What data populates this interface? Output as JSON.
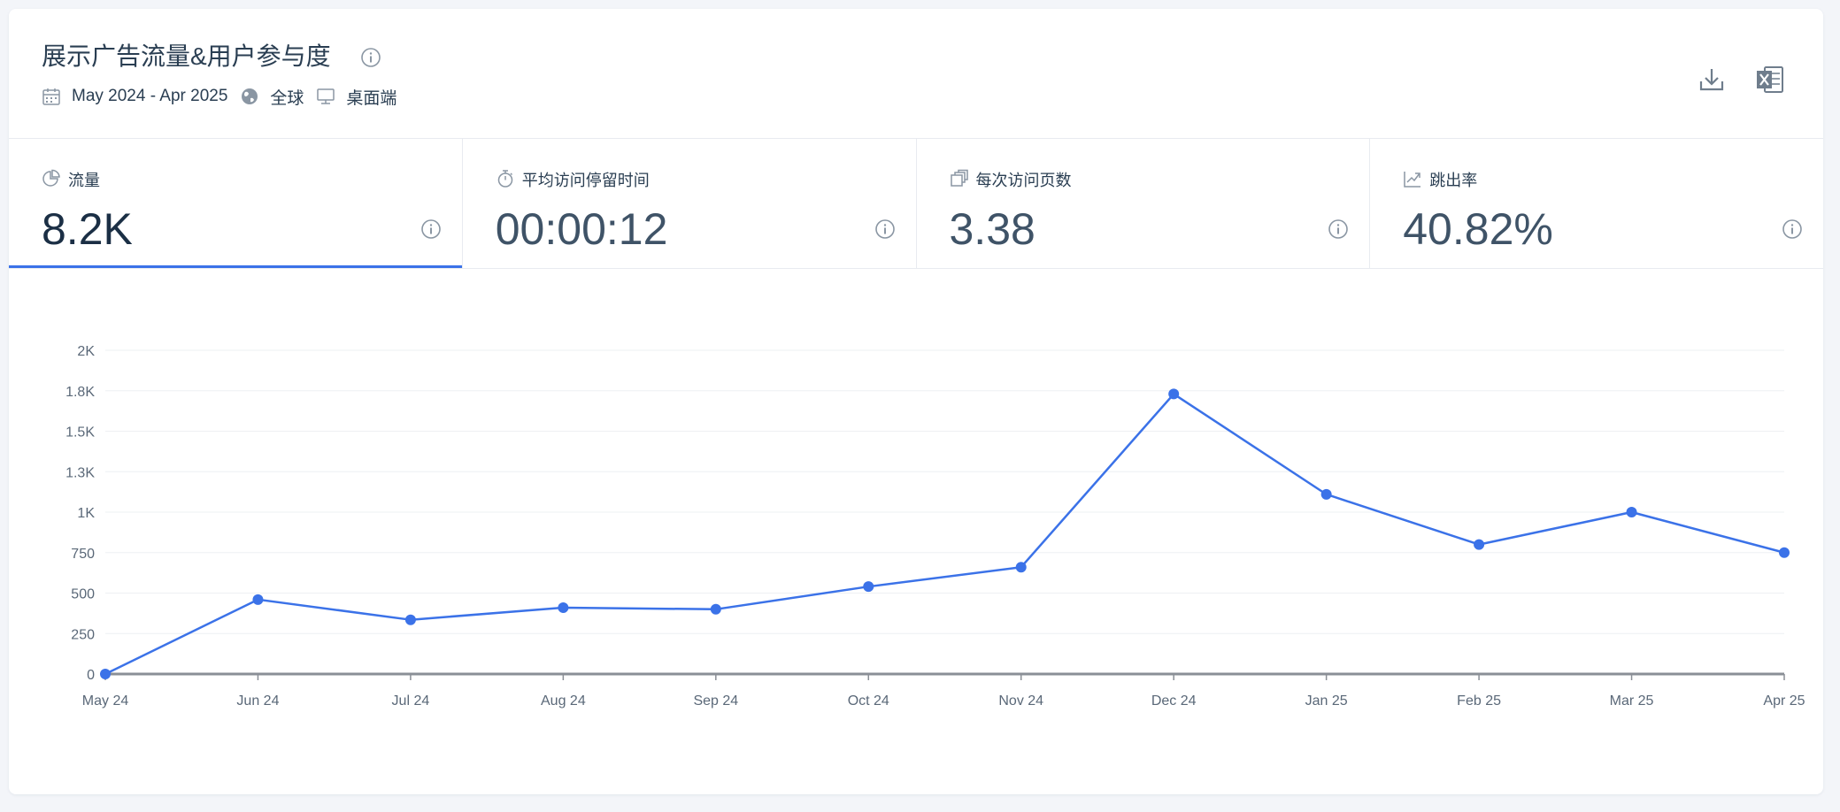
{
  "header": {
    "title": "展示广告流量&用户参与度",
    "date_range": "May 2024 - Apr 2025",
    "region": "全球",
    "device": "桌面端",
    "icons": {
      "title_info": "info-icon",
      "date": "calendar-icon",
      "region": "globe-icon",
      "device": "desktop-icon",
      "download": "download-icon",
      "excel": "excel-icon"
    }
  },
  "metrics": [
    {
      "label": "流量",
      "value": "8.2K",
      "icon": "pie-chart-icon",
      "active": true
    },
    {
      "label": "平均访问停留时间",
      "value": "00:00:12",
      "icon": "stopwatch-icon",
      "active": false
    },
    {
      "label": "每次访问页数",
      "value": "3.38",
      "icon": "pages-icon",
      "active": false
    },
    {
      "label": "跳出率",
      "value": "40.82%",
      "icon": "bounce-arrow-icon",
      "active": false
    }
  ],
  "colors": {
    "accent": "#3b72e8",
    "line": "#3b72e8",
    "grid": "#eef0f3",
    "axis": "#8a8f96"
  },
  "chart_data": {
    "type": "line",
    "categories": [
      "May 24",
      "Jun 24",
      "Jul 24",
      "Aug 24",
      "Sep 24",
      "Oct 24",
      "Nov 24",
      "Dec 24",
      "Jan 25",
      "Feb 25",
      "Mar 25",
      "Apr 25"
    ],
    "series": [
      {
        "values": [
          0,
          460,
          335,
          410,
          400,
          540,
          660,
          1730,
          1110,
          800,
          1000,
          750
        ]
      }
    ],
    "y_ticks": [
      0,
      250,
      500,
      750,
      1000,
      1250,
      1500,
      1750,
      2000
    ],
    "y_tick_labels": [
      "0",
      "250",
      "500",
      "750",
      "1K",
      "1.3K",
      "1.5K",
      "1.8K",
      "2K"
    ],
    "ylim": [
      0,
      2000
    ],
    "grid": true,
    "legend": "none"
  }
}
